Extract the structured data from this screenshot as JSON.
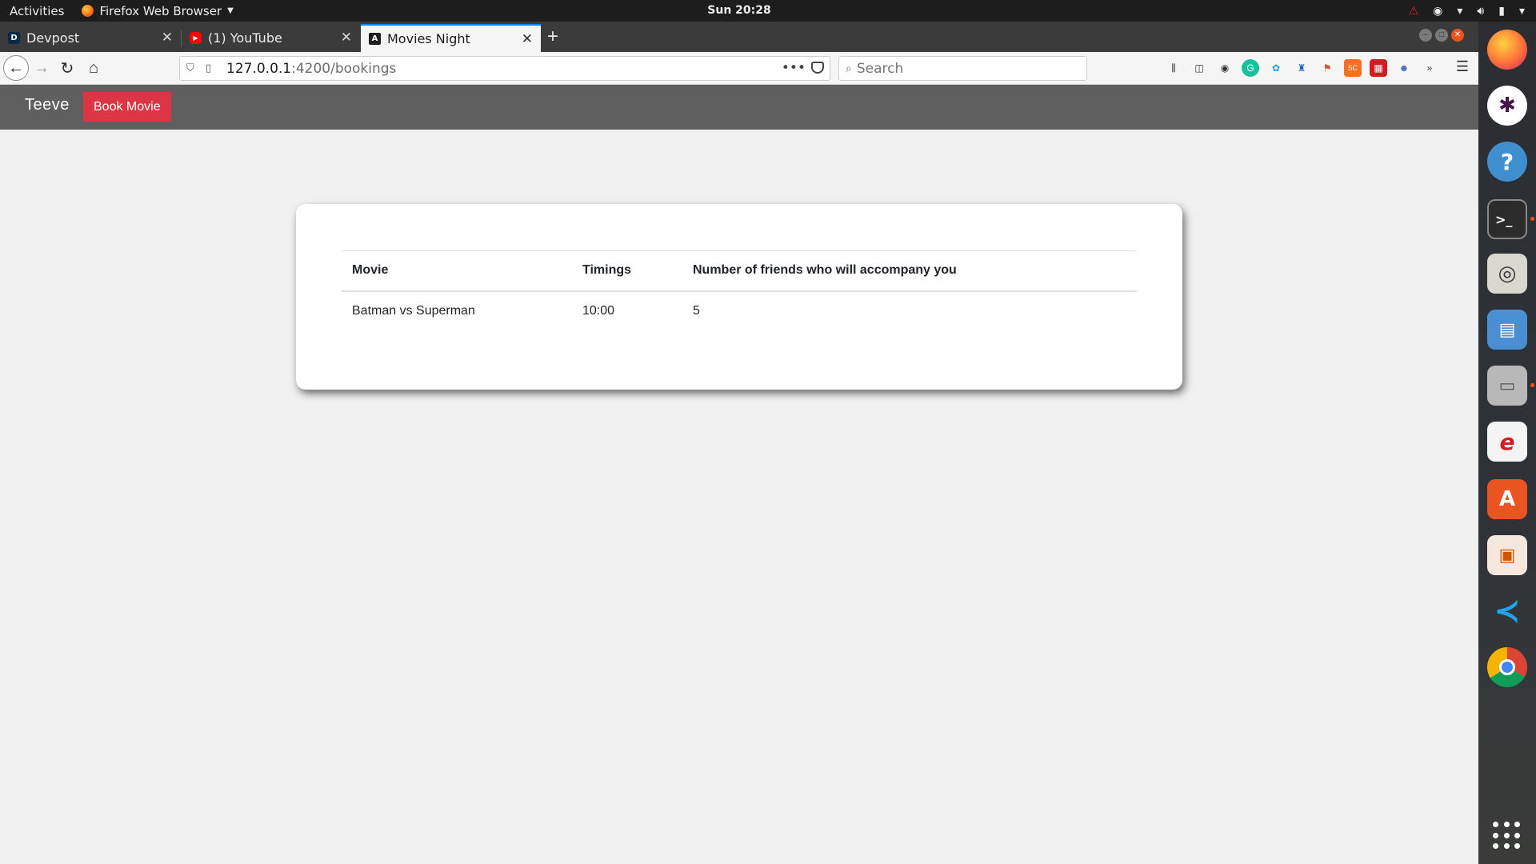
{
  "topbar": {
    "activities": "Activities",
    "app_name": "Firefox Web Browser",
    "clock": "Sun 20:28"
  },
  "tabs": [
    {
      "title": "Devpost",
      "favicon_letter": "D"
    },
    {
      "title": "(1) YouTube"
    },
    {
      "title": "Movies Night"
    }
  ],
  "nav": {
    "url_host": "127.0.0.1",
    "url_path": ":4200/bookings",
    "search_placeholder": "Search"
  },
  "app": {
    "brand": "Teeve",
    "book_button": "Book Movie",
    "accent_color": "#dc3545",
    "table": {
      "headers": [
        "Movie",
        "Timings",
        "Number of friends who will accompany you"
      ],
      "rows": [
        [
          "Batman vs Superman",
          "10:00",
          "5"
        ]
      ]
    }
  },
  "dock": {
    "items": [
      "firefox-icon",
      "slack-icon",
      "help-icon",
      "terminal-icon",
      "rhythmbox-icon",
      "image-viewer-icon",
      "file-manager-icon",
      "evolution-icon",
      "software-center-icon",
      "impress-icon",
      "vscode-icon",
      "chrome-icon"
    ]
  }
}
